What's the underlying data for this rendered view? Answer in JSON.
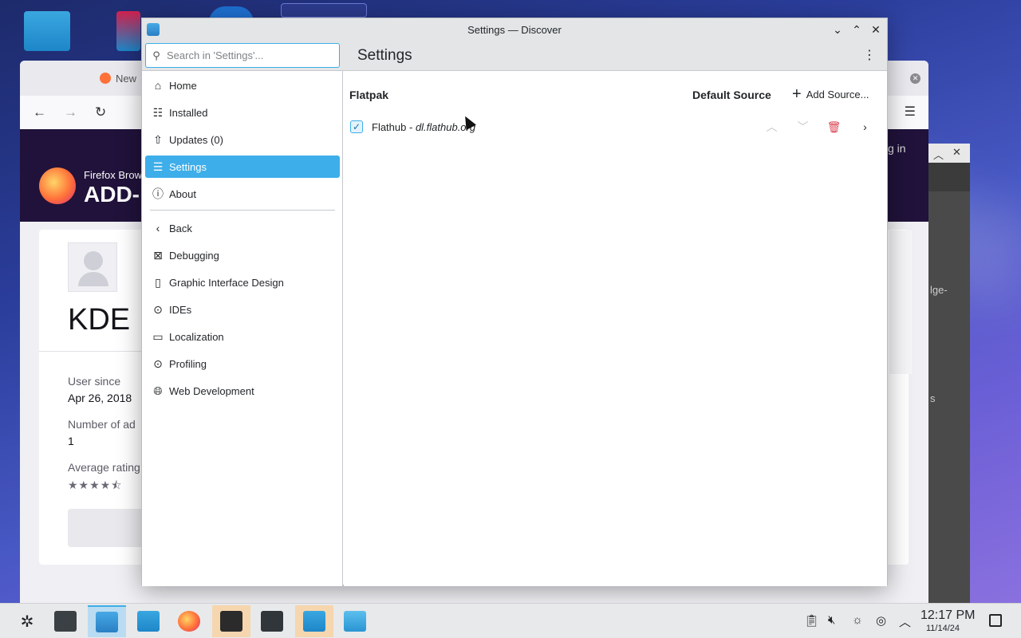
{
  "window": {
    "title": "Settings — Discover",
    "controls": [
      "minimize",
      "maximize",
      "close"
    ]
  },
  "toolbar": {
    "search_placeholder": "Search in 'Settings'...",
    "page_title": "Settings"
  },
  "sidebar": {
    "items": [
      {
        "label": "Home",
        "icon": "home-icon",
        "active": false
      },
      {
        "label": "Installed",
        "icon": "installed-icon",
        "active": false
      },
      {
        "label": "Updates (0)",
        "icon": "updates-icon",
        "active": false
      },
      {
        "label": "Settings",
        "icon": "settings-icon",
        "active": true
      },
      {
        "label": "About",
        "icon": "info-icon",
        "active": false
      }
    ],
    "secondary": [
      {
        "label": "Back",
        "icon": "chevron-left-icon"
      },
      {
        "label": "Debugging",
        "icon": "debugging-icon"
      },
      {
        "label": "Graphic Interface Design",
        "icon": "gui-design-icon"
      },
      {
        "label": "IDEs",
        "icon": "ide-icon"
      },
      {
        "label": "Localization",
        "icon": "localization-icon"
      },
      {
        "label": "Profiling",
        "icon": "profiling-icon"
      },
      {
        "label": "Web Development",
        "icon": "web-dev-icon"
      }
    ]
  },
  "content": {
    "section_title": "Flatpak",
    "default_source_label": "Default Source",
    "add_source_label": "Add Source...",
    "sources": [
      {
        "name": "Flathub",
        "separator": " - ",
        "url": "dl.flathub.org",
        "checked": true
      }
    ]
  },
  "background_window": {
    "brand_line1": "Firefox Brow",
    "brand_line2": "ADD-",
    "tab_label": "New",
    "profile_name": "KDE",
    "user_since_label": "User since",
    "user_since_value": "Apr 26, 2018",
    "num_addons_label": "Number of ad",
    "num_addons_value": "1",
    "avg_rating_label": "Average rating",
    "stars_glyph": "★★★★⯪",
    "login_fragment": "g in",
    "right_fragment1": "lge-",
    "right_fragment2": "s"
  },
  "taskbar": {
    "time": "12:17 PM",
    "date": "11/14/24"
  },
  "colors": {
    "accent": "#3daee9",
    "delete": "#da4453"
  }
}
